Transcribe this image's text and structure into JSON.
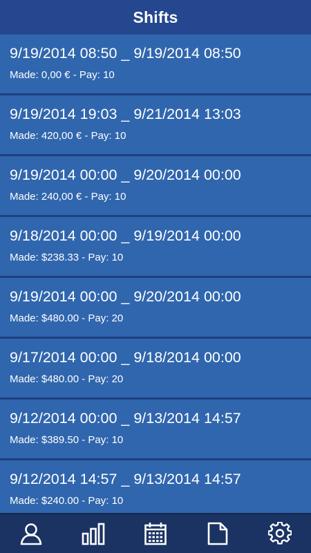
{
  "header": {
    "title": "Shifts"
  },
  "shifts": [
    {
      "range": "9/19/2014 08:50 _ 9/19/2014 08:50",
      "meta": "Made: 0,00 € - Pay: 10"
    },
    {
      "range": "9/19/2014 19:03 _ 9/21/2014 13:03",
      "meta": "Made: 420,00 € - Pay: 10"
    },
    {
      "range": "9/19/2014 00:00 _ 9/20/2014 00:00",
      "meta": "Made: 240,00 € - Pay: 10"
    },
    {
      "range": "9/18/2014 00:00 _ 9/19/2014 00:00",
      "meta": "Made: $238.33 - Pay: 10"
    },
    {
      "range": "9/19/2014 00:00 _ 9/20/2014 00:00",
      "meta": "Made: $480.00 - Pay: 20"
    },
    {
      "range": "9/17/2014 00:00 _ 9/18/2014 00:00",
      "meta": "Made: $480.00 - Pay: 20"
    },
    {
      "range": "9/12/2014 00:00 _ 9/13/2014 14:57",
      "meta": "Made: $389.50 - Pay: 10"
    },
    {
      "range": "9/12/2014 14:57 _ 9/13/2014 14:57",
      "meta": "Made: $240.00 - Pay: 10"
    }
  ],
  "tabbar": {
    "tabs": [
      {
        "icon": "user-icon"
      },
      {
        "icon": "bar-chart-icon"
      },
      {
        "icon": "calendar-icon"
      },
      {
        "icon": "document-icon"
      },
      {
        "icon": "gear-icon"
      }
    ]
  },
  "colors": {
    "header_bg": "#24478f",
    "item_bg": "#3066ae",
    "separator": "#1f3f7f",
    "tabbar_bg": "#1b3363",
    "text": "#ffffff"
  }
}
